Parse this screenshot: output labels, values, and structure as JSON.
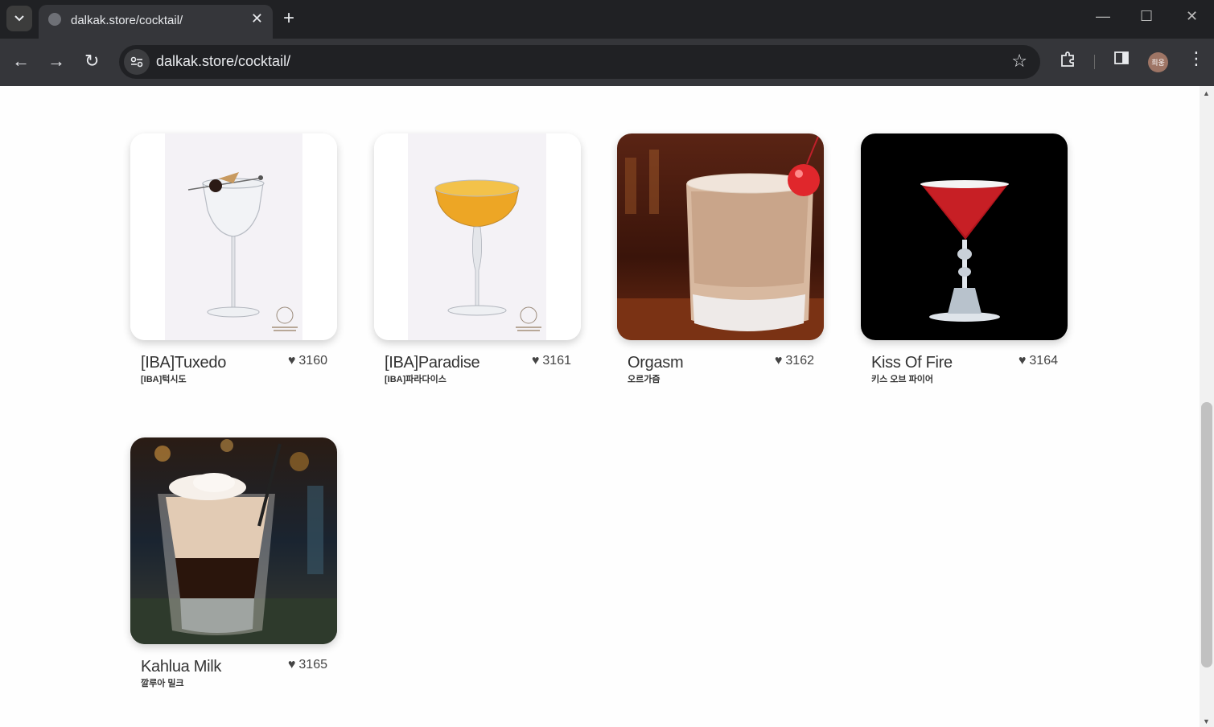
{
  "browser": {
    "tab_title": "dalkak.store/cocktail/",
    "url": "dalkak.store/cocktail/",
    "profile_initials": "희웅",
    "icons": [
      "tab-list-icon",
      "globe-icon",
      "close-icon",
      "plus-icon",
      "minimize-icon",
      "maximize-icon",
      "window-close-icon",
      "back-arrow-icon",
      "forward-arrow-icon",
      "reload-icon",
      "site-info-icon",
      "star-icon",
      "extensions-icon",
      "side-panel-icon",
      "menu-dots-icon"
    ]
  },
  "cocktails": [
    {
      "name": "[IBA]Tuxedo",
      "korean_name": "[IBA]턱시도",
      "likes": "3160"
    },
    {
      "name": "[IBA]Paradise",
      "korean_name": "[IBA]파라다이스",
      "likes": "3161"
    },
    {
      "name": "Orgasm",
      "korean_name": "오르가즘",
      "likes": "3162"
    },
    {
      "name": "Kiss Of Fire",
      "korean_name": "키스 오브 파이어",
      "likes": "3164"
    },
    {
      "name": "Kahlua Milk",
      "korean_name": "깔루아 밀크",
      "likes": "3165"
    }
  ]
}
